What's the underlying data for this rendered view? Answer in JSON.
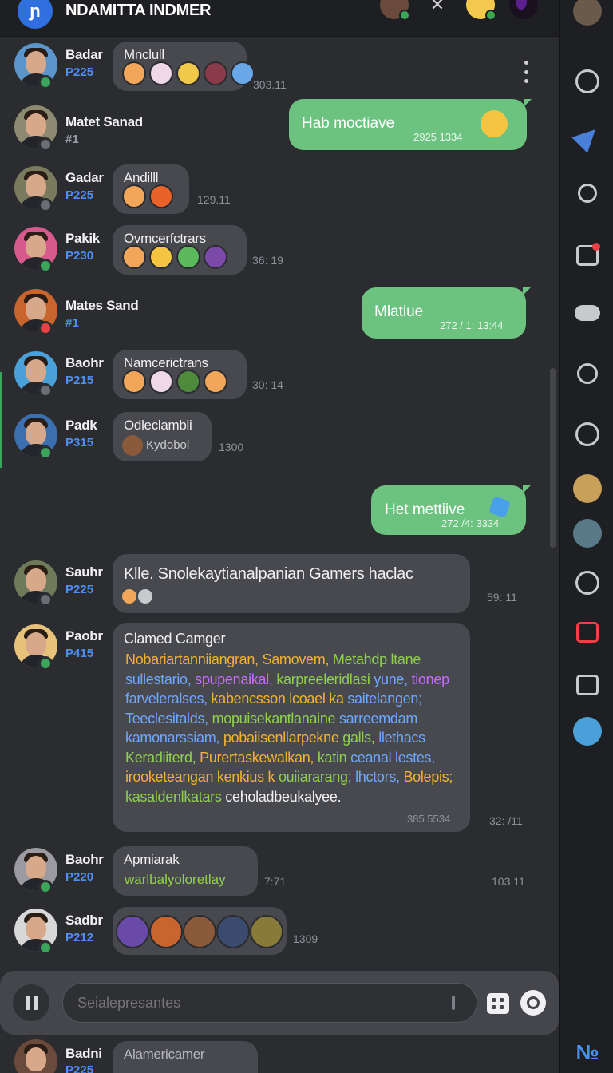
{
  "header": {
    "logo_letter": "ɲ",
    "title": "NDAMITTA INDMER"
  },
  "messages": [
    {
      "name": "Badar",
      "tag": "P225",
      "title": "Mnclull",
      "time": "303.11",
      "emojis": [
        "#f2a65a",
        "#f0d9e6",
        "#f0c84a",
        "#8a3b4a",
        "#6aa7e8"
      ],
      "avatar_bg": "#5b95c9",
      "badge": "green"
    },
    {
      "name": "Matet Sanad",
      "tag": "#1",
      "sent_text": "Hab moctiave",
      "sent_time": "2925 1334",
      "sent_emoji": "😎",
      "avatar_bg": "#8c8a70",
      "badge": "grey"
    },
    {
      "name": "Gadar",
      "tag": "P225",
      "title": "Andilll",
      "time": "129.11",
      "emojis": [
        "#f2a65a",
        "#e8622a"
      ],
      "avatar_bg": "#7a7a5e",
      "badge": "grey"
    },
    {
      "name": "Pakik",
      "tag": "P230",
      "title": "Ovmcerfctrars",
      "time": "36: 19",
      "emojis": [
        "#f2a65a",
        "#f5c542",
        "#5cb85c",
        "#7b4aa8"
      ],
      "avatar_bg": "#d65a8c",
      "badge": "green"
    },
    {
      "name": "Mates Sand",
      "tag": "#1",
      "sent_text": "Mlatiue",
      "sent_time": "272 / 1: 13:44",
      "avatar_bg": "#c8652f",
      "badge": "red"
    },
    {
      "name": "Baohr",
      "tag": "P215",
      "title": "Namcerictrans",
      "time": "30: 14",
      "emojis": [
        "#f2a65a",
        "#f0d9e6",
        "#4f8a3c",
        "#f2a65a"
      ],
      "avatar_bg": "#4aa0d8",
      "badge": "grey"
    },
    {
      "name": "Padk",
      "tag": "P315",
      "title": "Odleclambli",
      "subtitle": "Kydobol",
      "time": "1300",
      "avatar_bg": "#3b6fb0",
      "badge": "green"
    },
    {
      "name": "",
      "tag": "",
      "sent_text": "Het mettiive",
      "sent_time": "272 /4: 3334"
    },
    {
      "name": "Sauhr",
      "tag": "P225",
      "title": "Klle. Snolekaytianalpanian Gamers haclac",
      "time": "59: 11",
      "avatar_bg": "#6f7a5a",
      "badge": "grey"
    },
    {
      "name": "Paobr",
      "tag": "P415",
      "title": "Clamed Camger",
      "time_inner": "385 5534",
      "time": "32: /11",
      "avatar_bg": "#e8c27a",
      "badge": "green"
    },
    {
      "name": "Baohr",
      "tag": "P220",
      "title": "Apmiarak",
      "subtitle": "warlbalyoloretlay",
      "time_inner": "7:71",
      "time": "103 11",
      "avatar_bg": "#9a9aa0",
      "badge": "green"
    },
    {
      "name": "Sadbr",
      "tag": "P212",
      "time": "1309",
      "emojis": [
        "#6a4aa8",
        "#c8652f",
        "#8a5a3a",
        "#3b4a6f",
        "#8a7a3a"
      ],
      "avatar_bg": "#d8d8d8",
      "badge": "green"
    }
  ],
  "long_message": [
    {
      "text": "Nobariartanniiangran, ",
      "color": "#f2b233"
    },
    {
      "text": "Samovem, ",
      "color": "#f2b233"
    },
    {
      "text": "Metahdp ltane ",
      "color": "#8fd14f"
    },
    {
      "text": "sullestario, ",
      "color": "#6ea8ff"
    },
    {
      "text": "spupenaikal, ",
      "color": "#c76bff"
    },
    {
      "text": "karpreeleridlasi ",
      "color": "#8fd14f"
    },
    {
      "text": "yune, ",
      "color": "#6ea8ff"
    },
    {
      "text": "tionep ",
      "color": "#c76bff"
    },
    {
      "text": "farveleralses, ",
      "color": "#6ea8ff"
    },
    {
      "text": "kabencsson lcoael ka ",
      "color": "#f2b233"
    },
    {
      "text": "saitelangen; ",
      "color": "#6ea8ff"
    },
    {
      "text": "Teeclesitalds, ",
      "color": "#6ea8ff"
    },
    {
      "text": "mopuisekantlanaine ",
      "color": "#8fd14f"
    },
    {
      "text": "sarreemdam kamonarssiam, ",
      "color": "#6ea8ff"
    },
    {
      "text": "pobaiisenllarpekne ",
      "color": "#f2b233"
    },
    {
      "text": "galls, ",
      "color": "#8fd14f"
    },
    {
      "text": "llethacs ",
      "color": "#6ea8ff"
    },
    {
      "text": "Keradiiterd, ",
      "color": "#8fd14f"
    },
    {
      "text": "Purertaskewalkan, ",
      "color": "#f2b233"
    },
    {
      "text": "katin ",
      "color": "#8fd14f"
    },
    {
      "text": "ceanal lestes, ",
      "color": "#6ea8ff"
    },
    {
      "text": "irooketeangan kenkius k ",
      "color": "#f2b233"
    },
    {
      "text": "ouiiararang; ",
      "color": "#8fd14f"
    },
    {
      "text": "lhctors, ",
      "color": "#6ea8ff"
    },
    {
      "text": "Bolepis; ",
      "color": "#f2b233"
    },
    {
      "text": "kasaldenlkatars ",
      "color": "#8fd14f"
    },
    {
      "text": "ceholadbeukalyee.",
      "color": "#f0f0f0"
    }
  ],
  "peek": {
    "name": "Badni",
    "tag": "P225",
    "title": "Alamericamer"
  },
  "composer": {
    "placeholder": "Seialepresantes"
  },
  "rail": {
    "logo_text": "№"
  }
}
